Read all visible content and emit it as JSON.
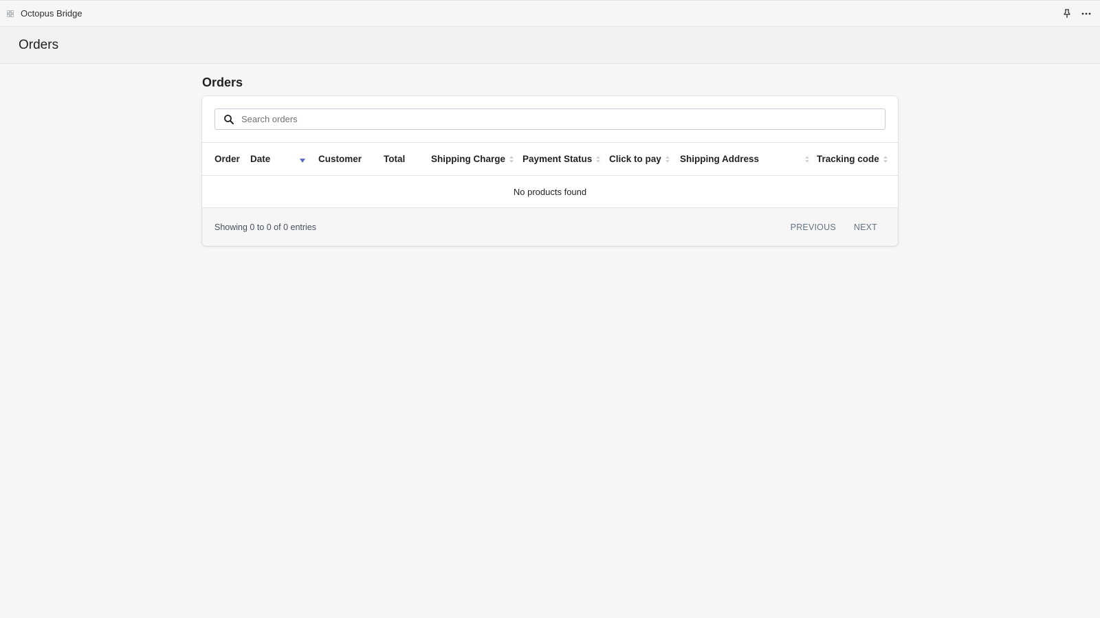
{
  "app": {
    "name": "Octopus Bridge",
    "icon": "app-grid-icon"
  },
  "topbar": {
    "pin_icon": "pin-icon",
    "more_icon": "more-horizontal-icon"
  },
  "page": {
    "title": "Orders"
  },
  "section": {
    "title": "Orders"
  },
  "search": {
    "placeholder": "Search orders",
    "value": "",
    "icon": "search-icon"
  },
  "table": {
    "columns": [
      {
        "label": "Order",
        "sortable": false
      },
      {
        "label": "Date",
        "sortable": true,
        "sorted": "desc"
      },
      {
        "label": "Customer",
        "sortable": false
      },
      {
        "label": "Total",
        "sortable": false
      },
      {
        "label": "Shipping Charge",
        "sortable": true
      },
      {
        "label": "Payment Status",
        "sortable": true
      },
      {
        "label": "Click to pay",
        "sortable": true
      },
      {
        "label": "Shipping Address",
        "sortable": true
      },
      {
        "label": "Tracking code",
        "sortable": true
      }
    ],
    "empty_message": "No products found"
  },
  "footer": {
    "info": "Showing 0 to 0 of 0 entries",
    "previous_label": "PREVIOUS",
    "next_label": "NEXT"
  },
  "colors": {
    "accent": "#5c6ac4",
    "background": "#f6f6f7"
  }
}
